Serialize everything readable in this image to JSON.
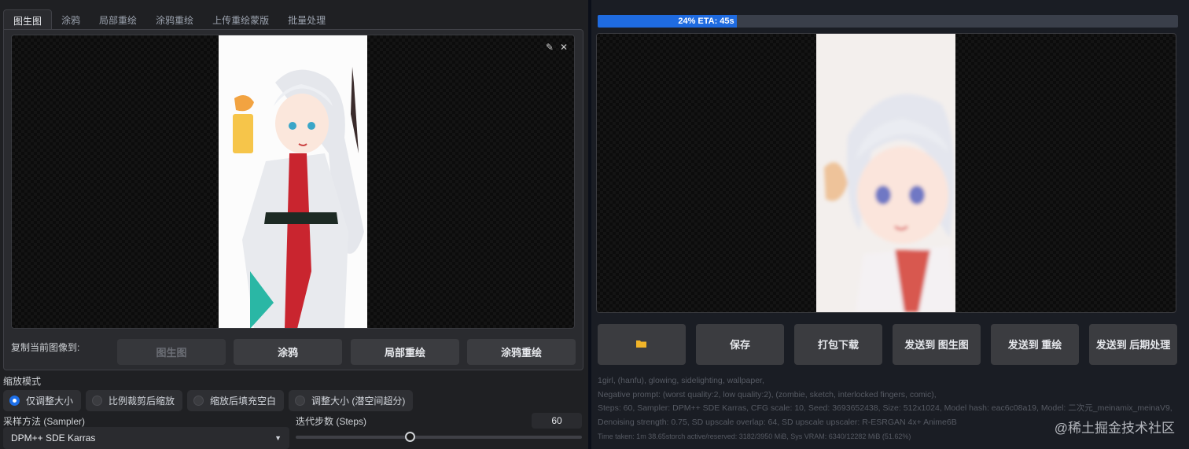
{
  "tabs": [
    "图生图",
    "涂鸦",
    "局部重绘",
    "涂鸦重绘",
    "上传重绘蒙版",
    "批量处理"
  ],
  "editor": {
    "edit_icon": "✎",
    "close_icon": "✕"
  },
  "copy": {
    "label": "复制当前图像到:",
    "buttons": [
      "图生图",
      "涂鸦",
      "局部重绘",
      "涂鸦重绘"
    ]
  },
  "resize": {
    "label": "缩放模式",
    "options": [
      "仅调整大小",
      "比例裁剪后缩放",
      "缩放后填充空白",
      "调整大小 (潜空间超分)"
    ],
    "selected_index": 0
  },
  "sampler": {
    "label": "采样方法 (Sampler)",
    "value": "DPM++ SDE Karras",
    "arrow": "▼"
  },
  "steps": {
    "label": "迭代步数 (Steps)",
    "value": "60",
    "fraction": 0.38
  },
  "progress": {
    "text": "24% ETA: 45s",
    "percent": 24
  },
  "output_buttons": {
    "folder_icon": "folder-icon",
    "save": "保存",
    "zip": "打包下载",
    "send_img2img": "发送到 图生图",
    "send_inpaint": "发送到 重绘",
    "send_extras": "发送到 后期处理"
  },
  "info": {
    "prompt": "1girl, (hanfu), glowing, sidelighting, wallpaper,",
    "negative": "Negative prompt: (worst quality:2, low quality:2), (zombie, sketch, interlocked fingers, comic),",
    "params": "Steps: 60, Sampler: DPM++ SDE Karras, CFG scale: 10, Seed: 3693652438, Size: 512x1024, Model hash: eac6c08a19, Model: 二次元_meinamix_meinaV9,",
    "params2": "Denoising strength: 0.75, SD upscale overlap: 64, SD upscale upscaler: R-ESRGAN 4x+ Anime6B",
    "time": "Time taken: 1m 38.65storch active/reserved: 3182/3950 MiB, Sys VRAM: 6340/12282 MiB (51.62%)"
  },
  "watermark": "@稀土掘金技术社区",
  "colors": {
    "accent": "#1f6be0",
    "background": "#0b0f19",
    "panel": "#1f2023"
  }
}
